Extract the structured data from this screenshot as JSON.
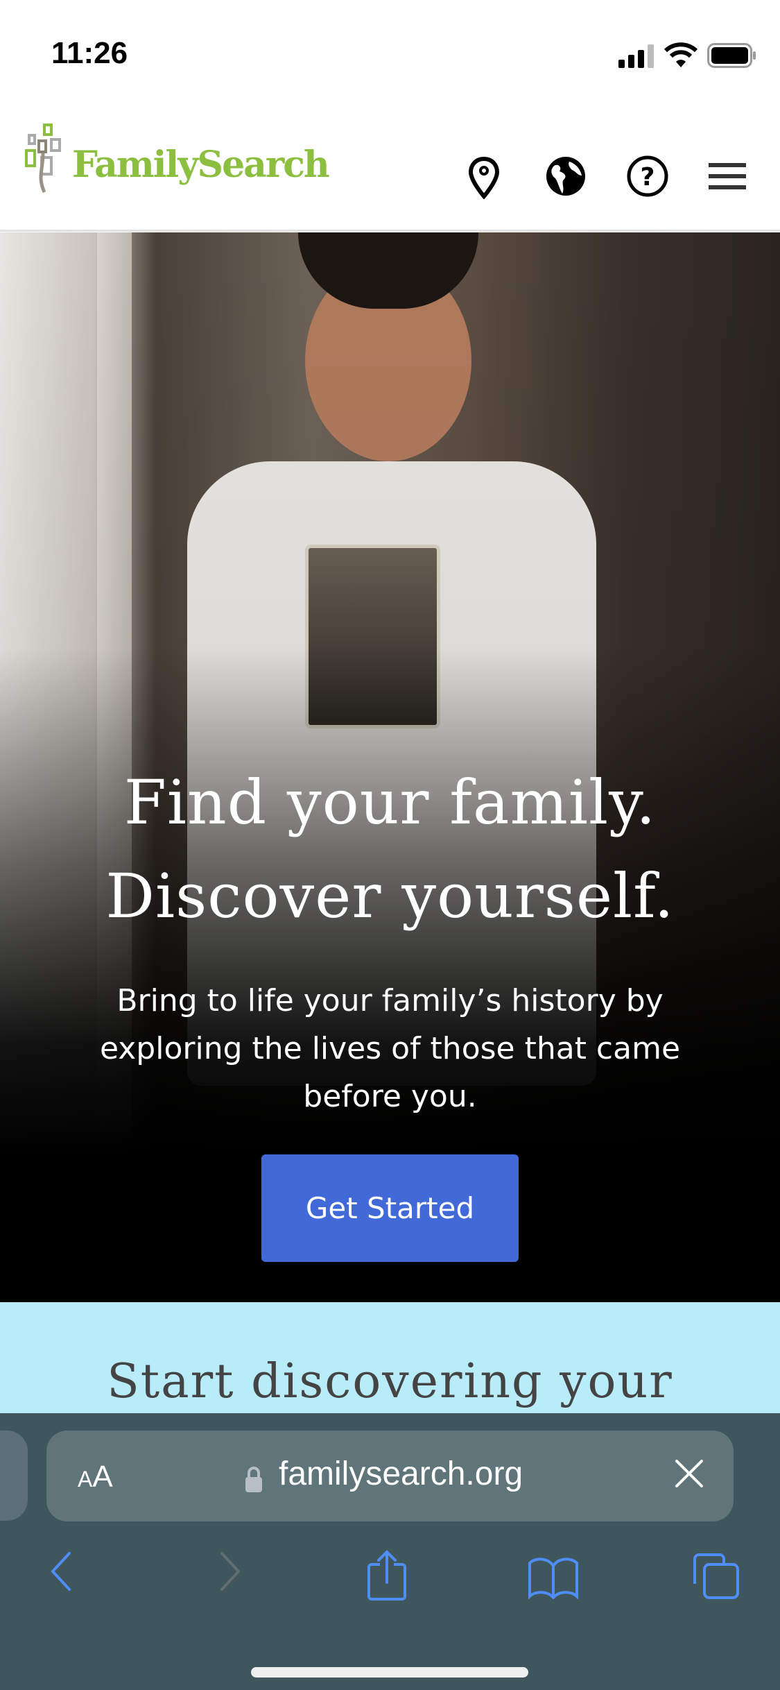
{
  "status_bar": {
    "time": "11:26"
  },
  "header": {
    "logo_text": "FamilySearch",
    "icons": [
      "location-pin-icon",
      "globe-icon",
      "help-icon",
      "menu-icon"
    ]
  },
  "hero": {
    "headline_line1": "Find your family.",
    "headline_line2": "Discover yourself.",
    "subtitle_line1": "Bring to life your family’s history by",
    "subtitle_line2": "exploring the lives of those that came",
    "subtitle_line3": "before you.",
    "cta_label": "Get Started"
  },
  "discover": {
    "title": "Start discovering your"
  },
  "browser": {
    "text_size_label_small": "A",
    "text_size_label_large": "A",
    "url": "familysearch.org",
    "toolbar": [
      "back-icon",
      "forward-icon",
      "share-icon",
      "bookmarks-icon",
      "tabs-icon"
    ]
  },
  "colors": {
    "brand_green": "#8cbf3f",
    "cta_blue": "#4169d8",
    "discover_bg": "#b8ecf8",
    "safari_bg": "#3f565c",
    "link_blue": "#4f8ef7"
  }
}
